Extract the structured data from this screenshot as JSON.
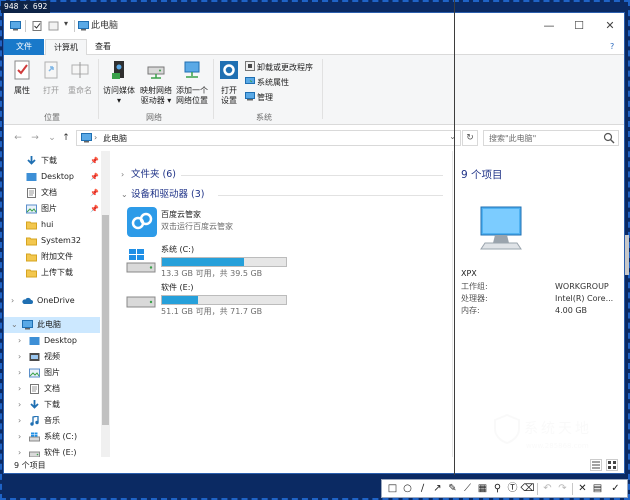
{
  "capture": {
    "dimensions": "948 x 692"
  },
  "window": {
    "title": "此电脑",
    "controls": {
      "minimize": "—",
      "maximize": "☐",
      "close": "✕"
    },
    "qat_dropdown": "▾",
    "help": "?"
  },
  "tabs": [
    {
      "label": "文件"
    },
    {
      "label": "计算机"
    },
    {
      "label": "查看"
    }
  ],
  "ribbon": {
    "location_group": {
      "label": "位置",
      "properties": "属性",
      "open": "打开",
      "rename": "重命名"
    },
    "network_group": {
      "label": "网络",
      "media": [
        "访问媒体",
        "▾"
      ],
      "map_drive": [
        "映射网络",
        "驱动器 ▾"
      ],
      "add_location": [
        "添加一个",
        "网络位置"
      ]
    },
    "system_group": {
      "label": "系统",
      "settings": [
        "打开",
        "设置"
      ],
      "uninstall": "卸载或更改程序",
      "system_props": "系统属性",
      "manage": "管理"
    }
  },
  "address": {
    "back": "←",
    "forward": "→",
    "recent": "⌄",
    "up": "↑",
    "path_sep": "›",
    "path": "此电脑",
    "dropdown": "⌄",
    "refresh": "↻",
    "search_placeholder": "搜索\"此电脑\""
  },
  "nav": {
    "quick_access": [
      {
        "label": "下载",
        "pinned": true
      },
      {
        "label": "Desktop",
        "pinned": true
      },
      {
        "label": "文档",
        "pinned": true
      },
      {
        "label": "图片",
        "pinned": true
      },
      {
        "label": "hui",
        "pinned": false
      },
      {
        "label": "System32",
        "pinned": false
      },
      {
        "label": "附加文件",
        "pinned": false
      },
      {
        "label": "上传下载",
        "pinned": false
      }
    ],
    "onedrive": "OneDrive",
    "this_pc": "此电脑",
    "pc_children": [
      "Desktop",
      "视频",
      "图片",
      "文档",
      "下载",
      "音乐",
      "系统 (C:)",
      "软件 (E:)"
    ],
    "pin_glyph": "📌"
  },
  "content": {
    "folders_group": "文件夹 (6)",
    "devices_group": "设备和驱动器 (3)",
    "baidu": {
      "name": "百度云管家",
      "sub": "双击运行百度云管家"
    },
    "drives": [
      {
        "name": "系统 (C:)",
        "info": "13.3 GB 可用，共 39.5 GB",
        "used_fraction": 0.66
      },
      {
        "name": "软件 (E:)",
        "info": "51.1 GB 可用，共 71.7 GB",
        "used_fraction": 0.29
      }
    ]
  },
  "preview": {
    "count": "9 个项目",
    "computer_name": "XPX",
    "rows": [
      {
        "label": "工作组:",
        "value": "WORKGROUP"
      },
      {
        "label": "处理器:",
        "value": "Intel(R) Core..."
      },
      {
        "label": "内存:",
        "value": "4.00 GB"
      }
    ]
  },
  "status": {
    "count": "9 个项目"
  },
  "toolbar": {
    "tools": [
      "□",
      "○",
      "∕",
      "↗",
      "✎",
      "⟋",
      "▦",
      "⚲",
      "Ⓣ",
      "⌫",
      "↶",
      "↷",
      "✕",
      "▤",
      "✓"
    ]
  },
  "watermark": {
    "text": "系统天地",
    "url": "www.285868.com"
  },
  "colors": {
    "accent": "#1979ca",
    "selection": "#cce8ff",
    "bar": "#26a0da",
    "frame": "#0b2a63"
  }
}
